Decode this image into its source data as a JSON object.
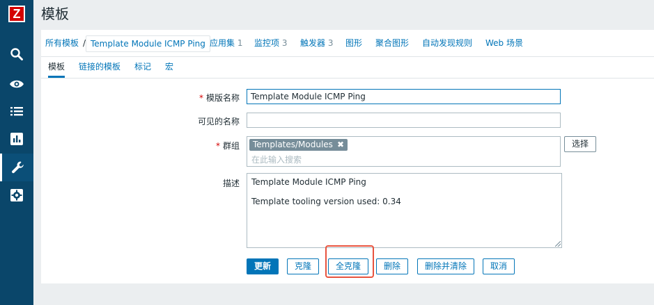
{
  "app": {
    "logo_letter": "Z",
    "brand_color": "#d40000",
    "sidebar_color": "#0a466a",
    "accent_color": "#0275b8",
    "highlight_color": "#e8533e"
  },
  "sidebar": {
    "items": [
      {
        "icon": "search-icon"
      },
      {
        "icon": "eye-icon"
      },
      {
        "icon": "list-icon"
      },
      {
        "icon": "chart-icon"
      },
      {
        "icon": "wrench-icon",
        "active": true
      },
      {
        "icon": "gear-icon"
      }
    ]
  },
  "page": {
    "title": "模板"
  },
  "nav": {
    "all_templates": "所有模板",
    "separator": "/",
    "current_template": "Template Module ICMP Ping",
    "applications": {
      "label": "应用集",
      "count": "1"
    },
    "items": {
      "label": "监控项",
      "count": "3"
    },
    "triggers": {
      "label": "触发器",
      "count": "3"
    },
    "graphs": "图形",
    "screens": "聚合图形",
    "discovery": "自动发现规则",
    "web": "Web 场景"
  },
  "tabs": {
    "template": "模板",
    "linked": "链接的模板",
    "tags": "标记",
    "macros": "宏"
  },
  "form": {
    "name_label": "模版名称",
    "name_value": "Template Module ICMP Ping",
    "visible_name_label": "可见的名称",
    "visible_name_value": "",
    "groups_label": "群组",
    "group_tag": "Templates/Modules",
    "group_tag_remove": "✖",
    "groups_placeholder": "在此输入搜索",
    "select_button": "选择",
    "description_label": "描述",
    "description_value": "Template Module ICMP Ping\n\nTemplate tooling version used: 0.34",
    "required_mark": "*"
  },
  "buttons": {
    "update": "更新",
    "clone": "克隆",
    "full_clone": "全克隆",
    "delete": "删除",
    "delete_clear": "删除并清除",
    "cancel": "取消"
  }
}
